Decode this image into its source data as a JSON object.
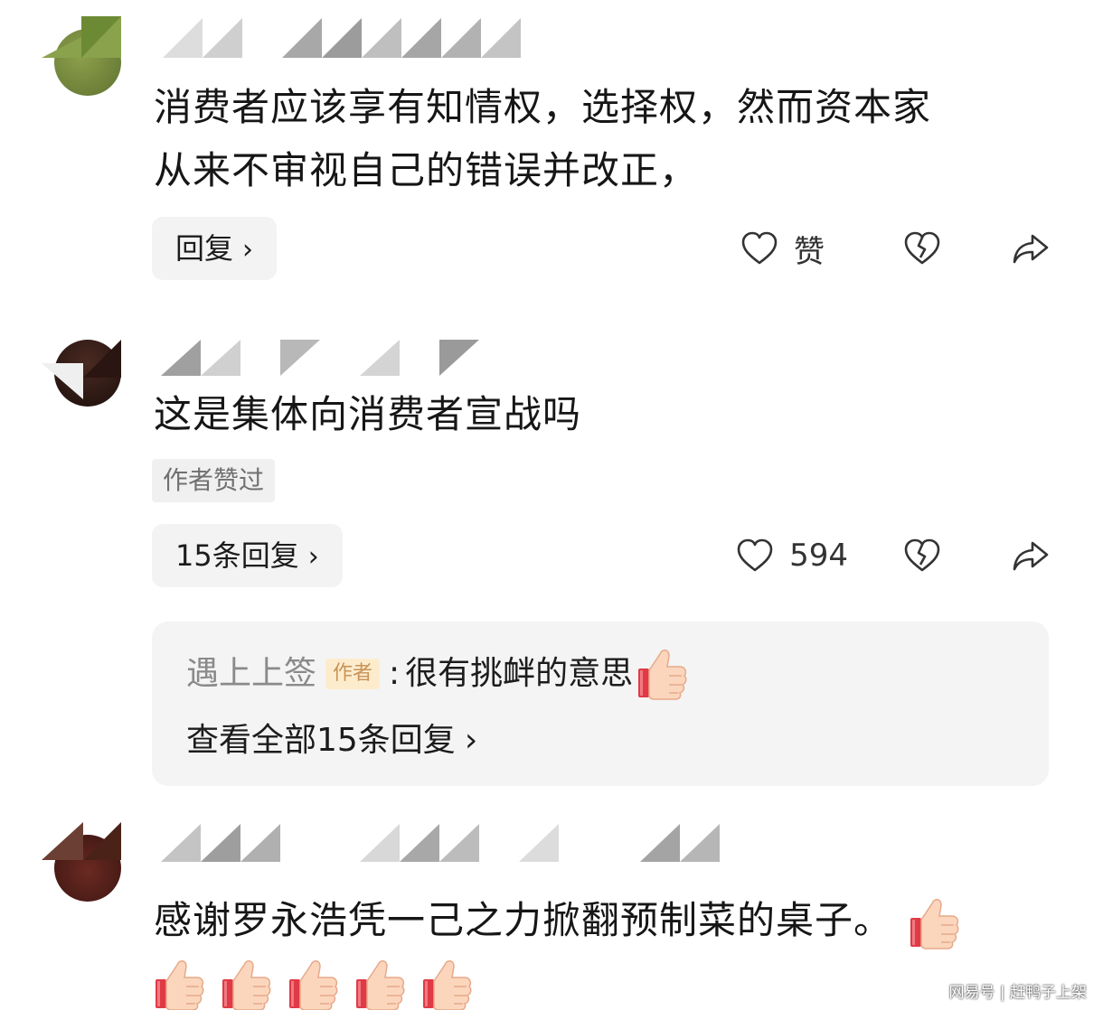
{
  "comments": [
    {
      "text_line1": "消费者应该享有知情权，选择权，然而资本家",
      "text_line2": "从来不审视自己的错误并改正，",
      "reply_label": "回复",
      "like_label": "赞"
    },
    {
      "text": "这是集体向消费者宣战吗",
      "author_liked_tag": "作者赞过",
      "reply_label": "15条回复",
      "like_count": "594",
      "nested_reply": {
        "author": "遇上上签",
        "author_badge": "作者",
        "separator": ":",
        "text": "很有挑衅的意思",
        "view_all": "查看全部15条回复"
      }
    },
    {
      "text": "感谢罗永浩凭一己之力掀翻预制菜的桌子。"
    }
  ],
  "watermark": "网易号 | 赶鸭子上架",
  "icons": {
    "heart": "heart-icon",
    "broken_heart": "broken-heart-icon",
    "share": "share-icon",
    "chevron": "chevron-right-icon",
    "thumbs_up": "thumbs-up-emoji"
  },
  "colors": {
    "pill_bg": "#f3f3f3",
    "reply_box_bg": "#f4f4f4",
    "badge_bg": "#fdeccc",
    "badge_text": "#c8935a",
    "muted_text": "#8a8a8a"
  }
}
